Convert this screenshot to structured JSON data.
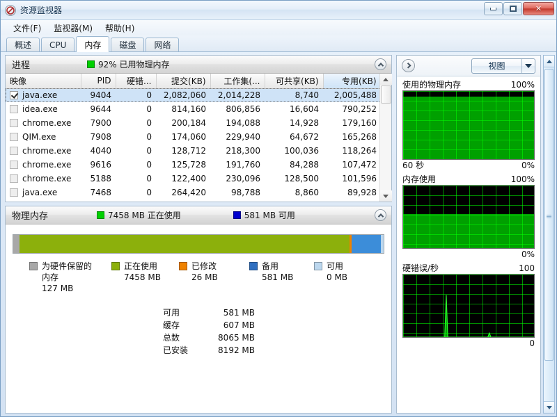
{
  "window": {
    "title": "资源监视器",
    "icon": "resource-monitor-icon",
    "buttons": {
      "minimize": "最小化",
      "maximize": "最大化",
      "close": "关闭"
    }
  },
  "menu": {
    "items": [
      "文件(F)",
      "监视器(M)",
      "帮助(H)"
    ]
  },
  "tabs": {
    "items": [
      {
        "label": "概述",
        "active": false
      },
      {
        "label": "CPU",
        "active": false
      },
      {
        "label": "内存",
        "active": true
      },
      {
        "label": "磁盘",
        "active": false
      },
      {
        "label": "网络",
        "active": false
      }
    ]
  },
  "processes": {
    "title": "进程",
    "status_text": "92% 已用物理内存",
    "status_swatch": "#00d000",
    "collapse_icon": "chevron-up-icon",
    "columns": [
      "映像",
      "PID",
      "硬错...",
      "提交(KB)",
      "工作集(...",
      "可共享(KB)",
      "专用(KB)"
    ],
    "sorted_column": "专用(KB)",
    "rows": [
      {
        "checked": true,
        "image": "java.exe",
        "pid": "9404",
        "hard_faults": "0",
        "commit": "2,082,060",
        "working_set": "2,014,228",
        "shareable": "8,740",
        "private": "2,005,488",
        "selected": true
      },
      {
        "checked": false,
        "image": "idea.exe",
        "pid": "9644",
        "hard_faults": "0",
        "commit": "814,160",
        "working_set": "806,856",
        "shareable": "16,604",
        "private": "790,252",
        "selected": false
      },
      {
        "checked": false,
        "image": "chrome.exe",
        "pid": "7900",
        "hard_faults": "0",
        "commit": "200,184",
        "working_set": "194,088",
        "shareable": "14,928",
        "private": "179,160",
        "selected": false
      },
      {
        "checked": false,
        "image": "QIM.exe",
        "pid": "7908",
        "hard_faults": "0",
        "commit": "174,060",
        "working_set": "229,940",
        "shareable": "64,672",
        "private": "165,268",
        "selected": false
      },
      {
        "checked": false,
        "image": "chrome.exe",
        "pid": "4040",
        "hard_faults": "0",
        "commit": "128,712",
        "working_set": "218,300",
        "shareable": "100,036",
        "private": "118,264",
        "selected": false
      },
      {
        "checked": false,
        "image": "chrome.exe",
        "pid": "9616",
        "hard_faults": "0",
        "commit": "125,728",
        "working_set": "191,760",
        "shareable": "84,288",
        "private": "107,472",
        "selected": false
      },
      {
        "checked": false,
        "image": "chrome.exe",
        "pid": "5188",
        "hard_faults": "0",
        "commit": "122,400",
        "working_set": "230,096",
        "shareable": "128,500",
        "private": "101,596",
        "selected": false
      },
      {
        "checked": false,
        "image": "java.exe",
        "pid": "7468",
        "hard_faults": "0",
        "commit": "264,420",
        "working_set": "98,788",
        "shareable": "8,860",
        "private": "89,928",
        "selected": false
      }
    ]
  },
  "physical_memory": {
    "title": "物理内存",
    "in_use_text": "7458 MB 正在使用",
    "in_use_swatch": "#00d000",
    "available_text": "581 MB 可用",
    "available_swatch": "#0000cd",
    "collapse_icon": "chevron-up-icon",
    "bar_segments": [
      {
        "name": "hardware-reserved",
        "color": "#a8a8a8",
        "percent": 1.6
      },
      {
        "name": "in-use",
        "color": "#8cb00c",
        "percent": 89.2
      },
      {
        "name": "modified",
        "color": "#ef8200",
        "percent": 0.5
      },
      {
        "name": "standby",
        "color": "#3c8dd9",
        "percent": 8.0
      },
      {
        "name": "free",
        "color": "#bcd7ee",
        "percent": 0.7
      }
    ],
    "legend": [
      {
        "color": "#a8a8a8",
        "label_line1": "为硬件保留的",
        "label_line2": "内存",
        "value": "127 MB"
      },
      {
        "color": "#8cb00c",
        "label_line1": "正在使用",
        "label_line2": "",
        "value": "7458 MB"
      },
      {
        "color": "#ef8200",
        "label_line1": "已修改",
        "label_line2": "",
        "value": "26 MB"
      },
      {
        "color": "#2f6fc0",
        "label_line1": "备用",
        "label_line2": "",
        "value": "581 MB"
      },
      {
        "color": "#bcd7ee",
        "label_line1": "可用",
        "label_line2": "",
        "value": "0 MB"
      }
    ],
    "stats": [
      {
        "key": "可用",
        "value": "581 MB"
      },
      {
        "key": "缓存",
        "value": "607 MB"
      },
      {
        "key": "总数",
        "value": "8065 MB"
      },
      {
        "key": "已安装",
        "value": "8192 MB"
      }
    ]
  },
  "graph_panel": {
    "expand_icon": "chevron-right-icon",
    "view_label": "视图",
    "view_arrow_icon": "chevron-down-icon",
    "graphs": [
      {
        "name": "physical-memory-used-graph",
        "title": "使用的物理内存",
        "top_label": "100%",
        "bottom_left_label": "60 秒",
        "bottom_right_label": "0%",
        "fill_percent": 92
      },
      {
        "name": "memory-usage-graph",
        "title": "内存使用",
        "top_label": "100%",
        "bottom_left_label": "",
        "bottom_right_label": "0%",
        "fill_percent": 55
      },
      {
        "name": "hard-faults-per-second-graph",
        "title": "硬错误/秒",
        "top_label": "100",
        "bottom_left_label": "",
        "bottom_right_label": "0",
        "fill_percent": 0
      }
    ]
  },
  "scrollbars": {
    "process_list": {
      "up_icon": "triangle-up-icon",
      "down_icon": "triangle-down-icon"
    },
    "outer": {
      "up_icon": "triangle-up-icon",
      "down_icon": "triangle-down-icon"
    }
  }
}
